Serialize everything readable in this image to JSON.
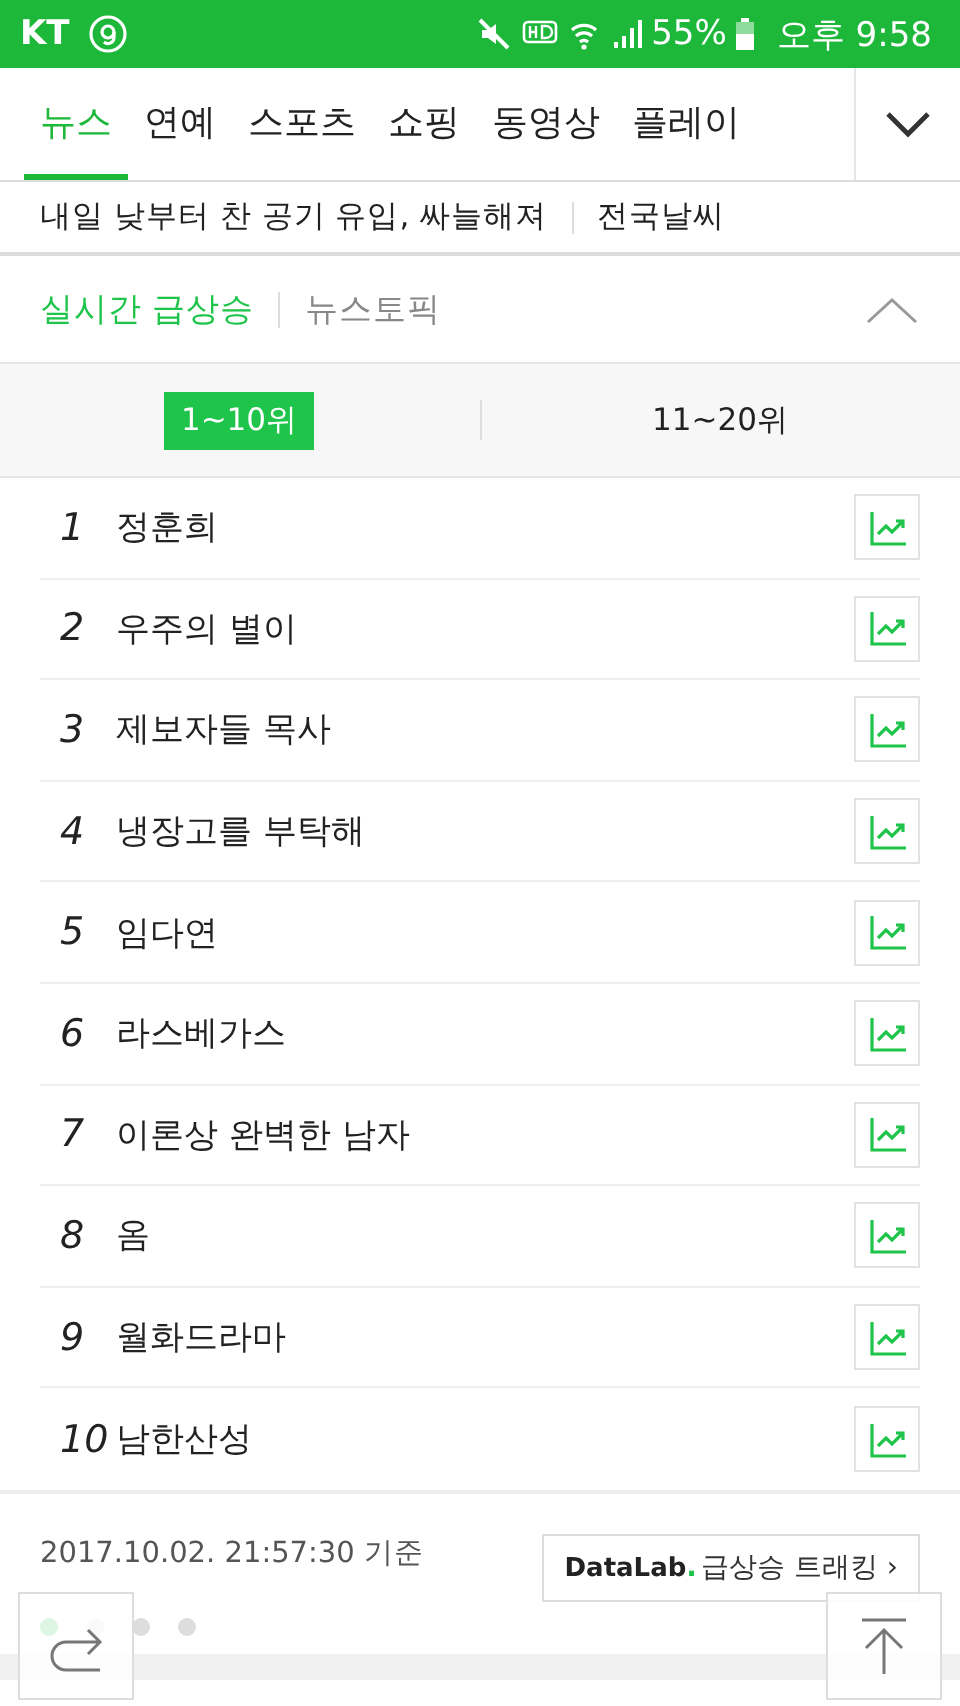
{
  "status_bar": {
    "carrier": "KT",
    "battery": "55%",
    "time": "오후 9:58"
  },
  "tabs": [
    {
      "label": "뉴스",
      "selected": true
    },
    {
      "label": "연예",
      "selected": false
    },
    {
      "label": "스포츠",
      "selected": false
    },
    {
      "label": "쇼핑",
      "selected": false
    },
    {
      "label": "동영상",
      "selected": false
    },
    {
      "label": "플레이",
      "selected": false
    }
  ],
  "headline": {
    "text": "내일 낮부터 찬 공기 유입, 싸늘해져",
    "link": "전국날씨"
  },
  "section_tabs": [
    {
      "label": "실시간 급상승",
      "selected": true
    },
    {
      "label": "뉴스토픽",
      "selected": false
    }
  ],
  "range_tabs": [
    {
      "label": "1~10위",
      "selected": true
    },
    {
      "label": "11~20위",
      "selected": false
    }
  ],
  "ranking": [
    {
      "rank": "1",
      "keyword": "정훈희"
    },
    {
      "rank": "2",
      "keyword": "우주의 별이"
    },
    {
      "rank": "3",
      "keyword": "제보자들 목사"
    },
    {
      "rank": "4",
      "keyword": "냉장고를 부탁해"
    },
    {
      "rank": "5",
      "keyword": "임다연"
    },
    {
      "rank": "6",
      "keyword": "라스베가스"
    },
    {
      "rank": "7",
      "keyword": "이론상 완벽한 남자"
    },
    {
      "rank": "8",
      "keyword": "옴"
    },
    {
      "rank": "9",
      "keyword": "월화드라마"
    },
    {
      "rank": "10",
      "keyword": "남한산성"
    }
  ],
  "footer": {
    "timestamp": "2017.10.02. 21:57:30 기준",
    "datalab_brand": "DataLab",
    "datalab_dot": ".",
    "datalab_label": "급상승 트래킹 ›"
  },
  "carousel_dots": [
    {
      "selected": true
    },
    {
      "selected": false
    },
    {
      "selected": false
    },
    {
      "selected": false
    }
  ]
}
